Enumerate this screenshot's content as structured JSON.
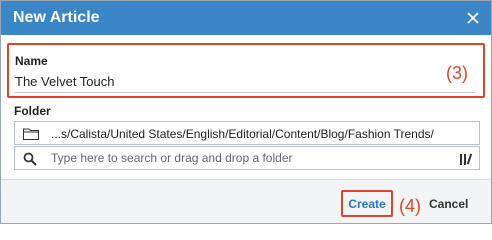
{
  "dialog": {
    "title": "New Article",
    "close_icon": "close-icon"
  },
  "name_field": {
    "label": "Name",
    "value": "The Velvet Touch",
    "callout": "(3)"
  },
  "folder_field": {
    "label": "Folder",
    "path": "...s/Calista/United States/English/Editorial/Content/Blog/Fashion Trends/",
    "folder_icon": "folder-icon",
    "search_icon": "search-icon",
    "search_placeholder": "Type here to search or drag and drop a folder",
    "library_icon": "library-icon"
  },
  "footer": {
    "create_label": "Create",
    "create_callout": "(4)",
    "cancel_label": "Cancel"
  },
  "colors": {
    "titlebar": "#3b86c6",
    "highlight": "#e0442b",
    "create_text": "#2f76b7"
  }
}
